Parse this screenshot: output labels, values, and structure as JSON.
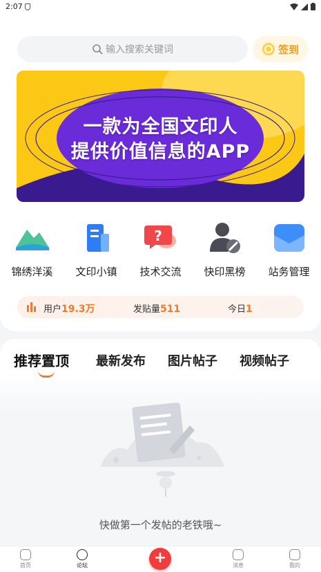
{
  "status": {
    "time": "2:07"
  },
  "search": {
    "placeholder": "输入搜索关键词"
  },
  "signin": {
    "label": "签到"
  },
  "banner": {
    "line1": "一款为全国文印人",
    "line2": "提供价值信息的APP"
  },
  "categories": [
    {
      "label": "锦绣洋溪",
      "icon": "mountain-icon"
    },
    {
      "label": "文印小镇",
      "icon": "building-icon"
    },
    {
      "label": "技术交流",
      "icon": "chat-question-icon"
    },
    {
      "label": "快印黑榜",
      "icon": "user-forbidden-icon"
    },
    {
      "label": "站务管理",
      "icon": "mail-icon"
    }
  ],
  "stats": {
    "users_label": "用户",
    "users_value": "19.3万",
    "posts_label": "发贴量",
    "posts_value": "511",
    "today_label": "今日",
    "today_value": "1"
  },
  "tabs": [
    "推荐置顶",
    "最新发布",
    "图片帖子",
    "视频帖子"
  ],
  "empty": {
    "text": "快做第一个发帖的老铁哦~"
  },
  "nav": [
    {
      "label": "首页"
    },
    {
      "label": "论坛"
    },
    {
      "label": "消息"
    },
    {
      "label": "我的"
    }
  ],
  "colors": {
    "accent": "#f07a2c",
    "banner_bg": "#fbc816",
    "banner_purple": "#6a2bd9",
    "plus": "#f03c3c"
  }
}
